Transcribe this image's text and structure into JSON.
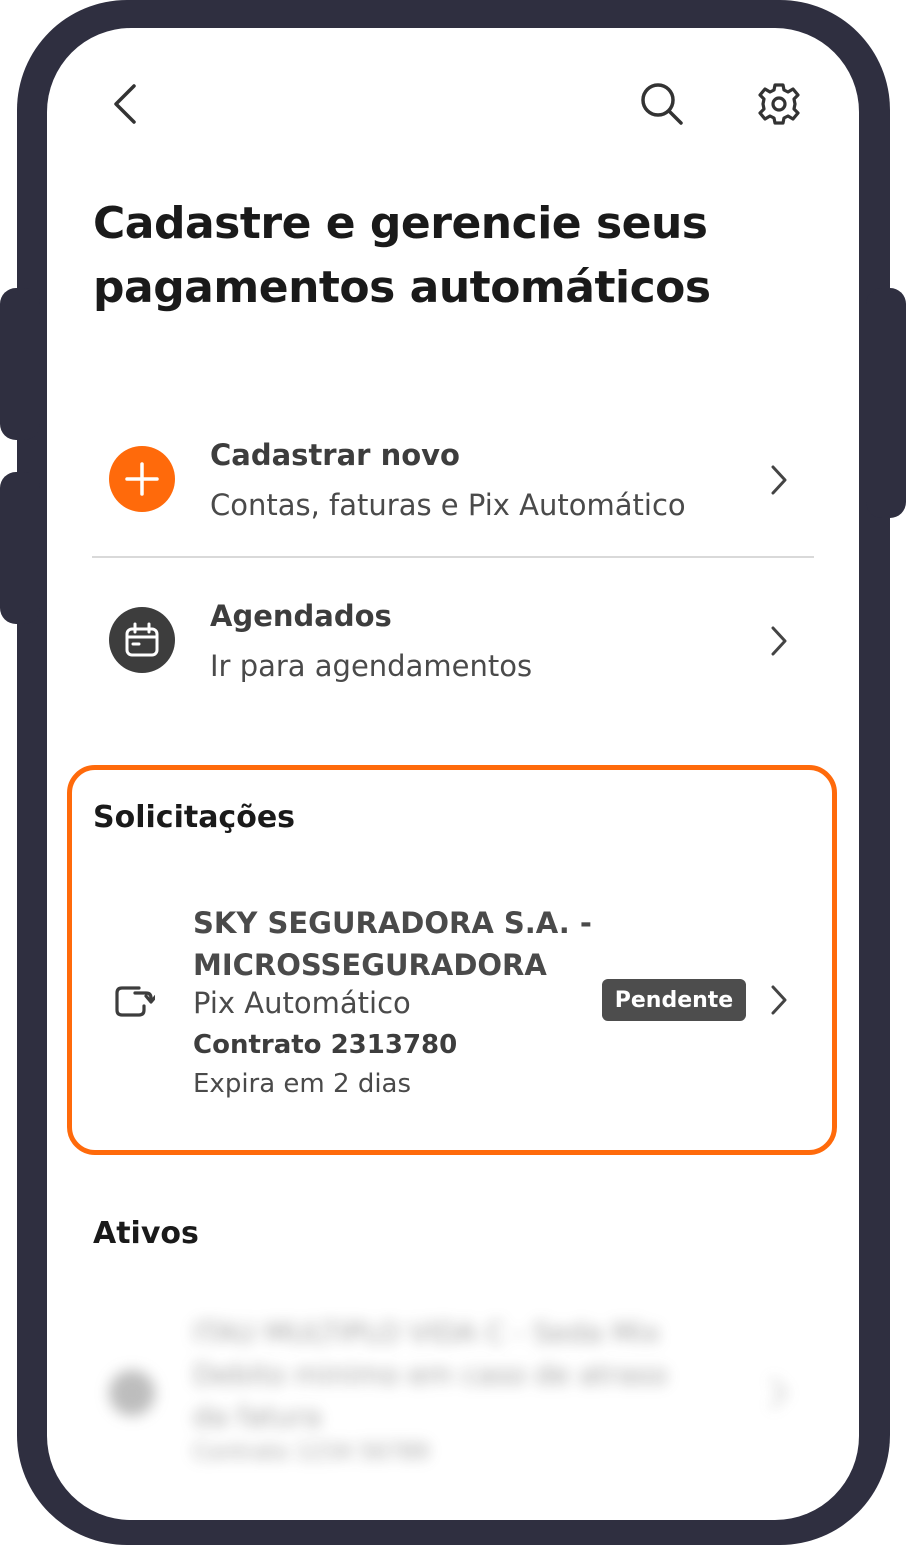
{
  "page": {
    "title": "Cadastre e gerencie seus pagamentos automáticos"
  },
  "header": {
    "back_icon": "chevron-left-icon",
    "search_icon": "search-icon",
    "settings_icon": "gear-icon"
  },
  "menu": [
    {
      "title": "Cadastrar novo",
      "subtitle": "Contas, faturas e Pix Automático",
      "icon": "plus-icon",
      "icon_bg": "#ff6a0b"
    },
    {
      "title": "Agendados",
      "subtitle": "Ir para agendamentos",
      "icon": "calendar-icon",
      "icon_bg": "#3d3d3d"
    }
  ],
  "requests": {
    "section_title": "Solicitações",
    "item": {
      "name": "SKY SEGURADORA S.A. - MICROSSEGURADORA",
      "type": "Pix Automático",
      "contract": "Contrato 2313780",
      "expires": "Expira em 2 dias",
      "status": "Pendente",
      "icon": "repeat-payment-icon"
    }
  },
  "active": {
    "section_title": "Ativos",
    "item": {
      "line1": "ITAU MULTIPLO VIDA C - Seda Mix",
      "line2": "Debito minimo em caso de atraso",
      "line3": "da fatura",
      "line4": "Contrato 1234 56789"
    }
  },
  "colors": {
    "accent": "#ff6a0b",
    "frame": "#2f2f40",
    "badge_bg": "#4d4d4d"
  }
}
